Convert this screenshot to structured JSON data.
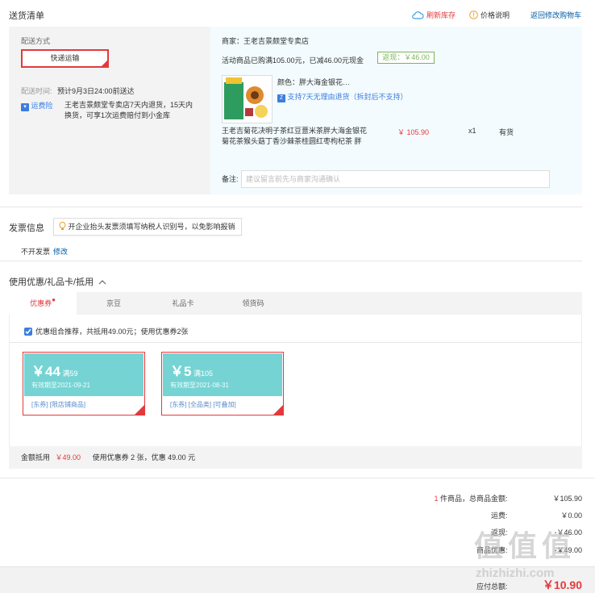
{
  "header": {
    "title": "送货清单",
    "refresh_label": "刷新库存",
    "price_label": "价格说明",
    "back_label": "返回修改购物车"
  },
  "delivery": {
    "method_label": "配送方式",
    "method_value": "快递运输",
    "time_label": "配送时间:",
    "time_value": "预计9月3日24:00前送达",
    "insurance_badge": "运费险",
    "insurance_text": "王老吉景颇堂专卖店7天内退货，15天内换货，可享1次运费赔付到小金库"
  },
  "order": {
    "seller": "商家：王老吉景颇堂专卖店",
    "promo": "活动商品已购满105.00元，已减46.00元现金",
    "cashback": "返现：￥46.00",
    "color": "颜色：胖大海金银花…",
    "return_policy": "支持7天无理由退货（拆封后不支持）",
    "product_name": "王老吉菊花决明子茶红豆薏米茶胖大海金银花菊花茶猴头菇丁香沙棘茶桂圆红枣枸杞茶 胖",
    "price": "￥ 105.90",
    "qty": "x1",
    "stock": "有货",
    "memo_label": "备注:",
    "memo_placeholder": "建议留言前先与商家沟通确认"
  },
  "invoice": {
    "title": "发票信息",
    "tip": "开企业抬头发票须填写纳税人识别号，以免影响报销",
    "value": "不开发票",
    "edit": "修改"
  },
  "coupons": {
    "title": "使用优惠/礼品卡/抵用",
    "tabs": [
      "优惠券",
      "京豆",
      "礼品卡",
      "领货码"
    ],
    "recommend": "优惠组合推荐，共抵用49.00元；使用优惠券2张",
    "items": [
      {
        "amount": "￥44",
        "min": "满59",
        "expires": "有效期至2021-09-21",
        "tags": "[东券] [限店铺商品]"
      },
      {
        "amount": "￥5",
        "min": "满105",
        "expires": "有效期至2021-08-31",
        "tags": "[东券] [全品类] [可叠加]"
      }
    ],
    "summary_label": "金额抵用",
    "summary_amount": "￥49.00",
    "summary_text": "使用优惠券 2 张，优惠 49.00 元"
  },
  "totals": {
    "count_prefix": "1",
    "count_label": "件商品，总商品金额:",
    "goods_amount": "￥105.90",
    "freight_label": "运费:",
    "freight_amount": "￥0.00",
    "cashback_label": "返现:",
    "cashback_amount": "-￥46.00",
    "coupon_label": "商品优惠:",
    "coupon_amount": "-￥49.00",
    "payable_label": "应付总额:",
    "payable_amount": "￥10.90"
  },
  "watermark": {
    "logo": "值 值 值",
    "site": "zhizhizhi.com"
  },
  "colors": {
    "accent": "#e4393c",
    "link": "#005aa0",
    "coupon": "#76d3d3",
    "green": "#7ab55c"
  }
}
